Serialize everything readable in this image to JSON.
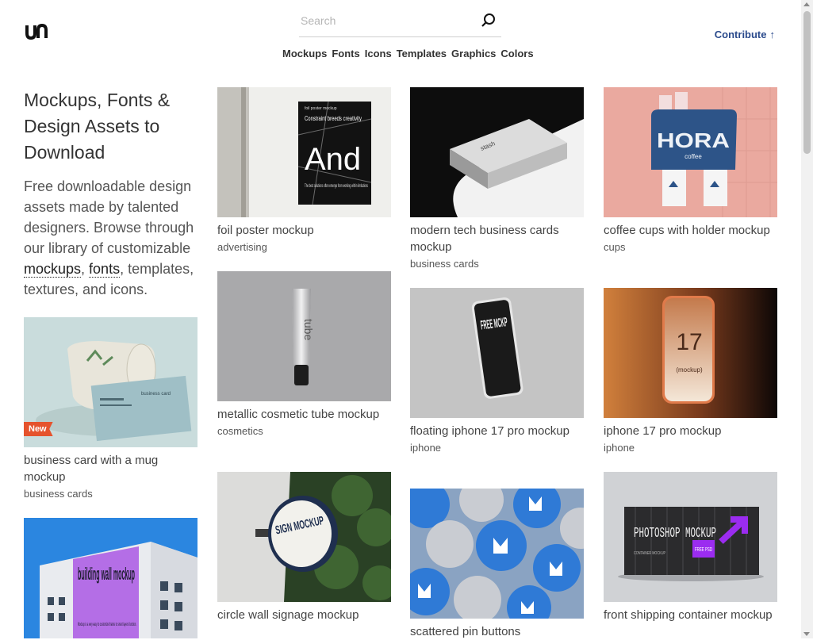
{
  "header": {
    "logo_text": "un",
    "search_placeholder": "Search",
    "nav": [
      "Mockups",
      "Fonts",
      "Icons",
      "Templates",
      "Graphics",
      "Colors"
    ],
    "contribute_label": "Contribute",
    "contribute_arrow": "↑"
  },
  "hero": {
    "title": "Mockups, Fonts & Design Assets to Download",
    "text_before": "Free downloadable design assets made by talented designers. Browse through our library of customizable ",
    "link_mockups": "mockups",
    "comma": ", ",
    "link_fonts": "fonts",
    "text_after": ", templates, textures, and icons."
  },
  "cards": [
    {
      "title": "business card with a mug mockup",
      "category": "business cards",
      "badge": "New"
    },
    {
      "title": "",
      "category": ""
    },
    {
      "title": "foil poster mockup",
      "category": "advertising"
    },
    {
      "title": "metallic cosmetic tube mockup",
      "category": "cosmetics"
    },
    {
      "title": "circle wall signage mockup",
      "category": ""
    },
    {
      "title": "modern tech business cards mockup",
      "category": "business cards"
    },
    {
      "title": "floating iphone 17 pro mockup",
      "category": "iphone"
    },
    {
      "title": "scattered pin buttons",
      "category": ""
    },
    {
      "title": "coffee cups with holder mockup",
      "category": "cups"
    },
    {
      "title": "iphone 17 pro mockup",
      "category": "iphone"
    },
    {
      "title": "front shipping container mockup",
      "category": ""
    }
  ],
  "image_text": {
    "poster_small": "foil poster mockup",
    "poster_headline": "Constraint breeds creativity",
    "poster_big": "And",
    "poster_body": "The best solutions often emerge from working within limitations",
    "mug_card_title": "business card",
    "building_text": "building wall mockup",
    "building_body": "Mockup is a very easy to customize thanks to smart layers function.",
    "tube_label": "tube",
    "bizcard_label": "stash",
    "cup_brand": "HORA",
    "cup_sub": "coffee",
    "phone_float_text": "FREE MCKP",
    "phone_number": "17",
    "phone_sub": "(mockup)",
    "sign_text": "SIGN MOCKUP",
    "container_text": "PHOTOSHOP MOCKUP",
    "container_free": "FREE PSD",
    "container_sub": "CONTAINER MOCKUP"
  },
  "colors": {
    "contribute": "#2a4a8c",
    "badge": "#e5532d"
  }
}
